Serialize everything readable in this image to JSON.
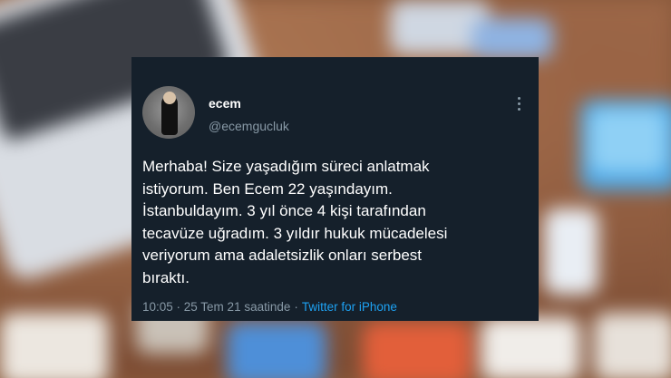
{
  "tweet": {
    "name": "ecem",
    "handle": "@ecemgucluk",
    "text": "Merhaba! Size yaşadığım süreci anlatmak\nistiyorum. Ben Ecem 22 yaşındayım.\nİstanbuldayım. 3 yıl önce 4 kişi tarafından\ntecavüze uğradım. 3 yıldır hukuk mücadelesi\nveriyorum ama adaletsizlik onları serbest\nbıraktı.",
    "timestamp": "10:05 · 25 Tem 21 saatinde",
    "separator": "·",
    "source": "Twitter for iPhone",
    "more_icon": "more-vertical-icon"
  },
  "colors": {
    "card_bg": "#15202b",
    "text": "#ffffff",
    "muted": "#8899a6",
    "link": "#1da1f2"
  }
}
